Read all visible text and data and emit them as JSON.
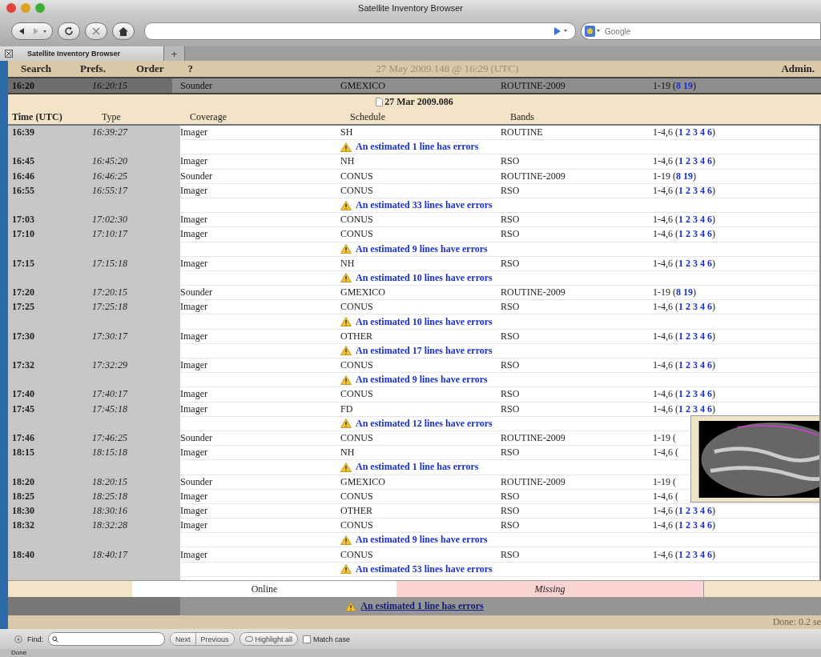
{
  "window": {
    "title": "Satellite Inventory Browser"
  },
  "toolbar": {
    "search_placeholder": "Google"
  },
  "tabs": [
    {
      "label": "Satellite Inventory Browser",
      "selected": true
    }
  ],
  "new_tab": "+",
  "menu": {
    "items": [
      "Search",
      "Prefs.",
      "Order",
      "?"
    ],
    "timestamp": "27 May 2009.148 @ 16:29 (UTC)",
    "admin": "Admin."
  },
  "current": {
    "time": "16:20",
    "time_exact": "16:20:15",
    "type": "Sounder",
    "coverage": "GMEXICO",
    "schedule": "ROUTINE-2009",
    "bands": {
      "prefix": "1-19 (",
      "links": [
        "8",
        "19"
      ],
      "suffix": ")"
    }
  },
  "date_header": "27 Mar 2009.086",
  "columns": [
    "Time (UTC)",
    "Type",
    "Coverage",
    "Schedule",
    "Bands"
  ],
  "rows": [
    {
      "kind": "data",
      "time": "16:39",
      "time_exact": "16:39:27",
      "type": "Imager",
      "coverage": "SH",
      "schedule": "ROUTINE",
      "bands": {
        "prefix": "1-4,6 (",
        "links": [
          "1",
          "2",
          "3",
          "4",
          "6"
        ],
        "suffix": ")"
      }
    },
    {
      "kind": "error",
      "text": "An estimated 1 line has errors"
    },
    {
      "kind": "data",
      "time": "16:45",
      "time_exact": "16:45:20",
      "type": "Imager",
      "coverage": "NH",
      "schedule": "RSO",
      "bands": {
        "prefix": "1-4,6 (",
        "links": [
          "1",
          "2",
          "3",
          "4",
          "6"
        ],
        "suffix": ")"
      }
    },
    {
      "kind": "data",
      "time": "16:46",
      "time_exact": "16:46:25",
      "type": "Sounder",
      "coverage": "CONUS",
      "schedule": "ROUTINE-2009",
      "bands": {
        "prefix": "1-19 (",
        "links": [
          "8",
          "19"
        ],
        "suffix": ")"
      }
    },
    {
      "kind": "data",
      "time": "16:55",
      "time_exact": "16:55:17",
      "type": "Imager",
      "coverage": "CONUS",
      "schedule": "RSO",
      "bands": {
        "prefix": "1-4,6 (",
        "links": [
          "1",
          "2",
          "3",
          "4",
          "6"
        ],
        "suffix": ")"
      }
    },
    {
      "kind": "error",
      "text": "An estimated 33 lines have errors"
    },
    {
      "kind": "data",
      "time": "17:03",
      "time_exact": "17:02:30",
      "type": "Imager",
      "coverage": "CONUS",
      "schedule": "RSO",
      "bands": {
        "prefix": "1-4,6 (",
        "links": [
          "1",
          "2",
          "3",
          "4",
          "6"
        ],
        "suffix": ")"
      }
    },
    {
      "kind": "data",
      "time": "17:10",
      "time_exact": "17:10:17",
      "type": "Imager",
      "coverage": "CONUS",
      "schedule": "RSO",
      "bands": {
        "prefix": "1-4,6 (",
        "links": [
          "1",
          "2",
          "3",
          "4",
          "6"
        ],
        "suffix": ")"
      }
    },
    {
      "kind": "error",
      "text": "An estimated 9 lines have errors"
    },
    {
      "kind": "data",
      "time": "17:15",
      "time_exact": "17:15:18",
      "type": "Imager",
      "coverage": "NH",
      "schedule": "RSO",
      "bands": {
        "prefix": "1-4,6 (",
        "links": [
          "1",
          "2",
          "3",
          "4",
          "6"
        ],
        "suffix": ")"
      }
    },
    {
      "kind": "error",
      "text": "An estimated 10 lines have errors"
    },
    {
      "kind": "data",
      "time": "17:20",
      "time_exact": "17:20:15",
      "type": "Sounder",
      "coverage": "GMEXICO",
      "schedule": "ROUTINE-2009",
      "bands": {
        "prefix": "1-19 (",
        "links": [
          "8",
          "19"
        ],
        "suffix": ")"
      }
    },
    {
      "kind": "data",
      "time": "17:25",
      "time_exact": "17:25:18",
      "type": "Imager",
      "coverage": "CONUS",
      "schedule": "RSO",
      "bands": {
        "prefix": "1-4,6 (",
        "links": [
          "1",
          "2",
          "3",
          "4",
          "6"
        ],
        "suffix": ")"
      }
    },
    {
      "kind": "error",
      "text": "An estimated 10 lines have errors"
    },
    {
      "kind": "data",
      "time": "17:30",
      "time_exact": "17:30:17",
      "type": "Imager",
      "coverage": "OTHER",
      "schedule": "RSO",
      "bands": {
        "prefix": "1-4,6 (",
        "links": [
          "1",
          "2",
          "3",
          "4",
          "6"
        ],
        "suffix": ")"
      }
    },
    {
      "kind": "error",
      "text": "An estimated 17 lines have errors"
    },
    {
      "kind": "data",
      "time": "17:32",
      "time_exact": "17:32:29",
      "type": "Imager",
      "coverage": "CONUS",
      "schedule": "RSO",
      "bands": {
        "prefix": "1-4,6 (",
        "links": [
          "1",
          "2",
          "3",
          "4",
          "6"
        ],
        "suffix": ")"
      }
    },
    {
      "kind": "error",
      "text": "An estimated 9 lines have errors"
    },
    {
      "kind": "data",
      "time": "17:40",
      "time_exact": "17:40:17",
      "type": "Imager",
      "coverage": "CONUS",
      "schedule": "RSO",
      "bands": {
        "prefix": "1-4,6 (",
        "links": [
          "1",
          "2",
          "3",
          "4",
          "6"
        ],
        "suffix": ")"
      }
    },
    {
      "kind": "data",
      "time": "17:45",
      "time_exact": "17:45:18",
      "type": "Imager",
      "coverage": "FD",
      "schedule": "RSO",
      "bands": {
        "prefix": "1-4,6 (",
        "links": [
          "1",
          "2",
          "3",
          "4",
          "6"
        ],
        "suffix": ")"
      }
    },
    {
      "kind": "error",
      "text": "An estimated 12 lines have errors"
    },
    {
      "kind": "data",
      "time": "17:46",
      "time_exact": "17:46:25",
      "type": "Sounder",
      "coverage": "CONUS",
      "schedule": "ROUTINE-2009",
      "bands": {
        "prefix": "1-19 ("
      }
    },
    {
      "kind": "data",
      "time": "18:15",
      "time_exact": "18:15:18",
      "type": "Imager",
      "coverage": "NH",
      "schedule": "RSO",
      "bands": {
        "prefix": "1-4,6 ("
      }
    },
    {
      "kind": "error",
      "text": "An estimated 1 line has errors"
    },
    {
      "kind": "data",
      "time": "18:20",
      "time_exact": "18:20:15",
      "type": "Sounder",
      "coverage": "GMEXICO",
      "schedule": "ROUTINE-2009",
      "bands": {
        "prefix": "1-19 ("
      }
    },
    {
      "kind": "data",
      "time": "18:25",
      "time_exact": "18:25:18",
      "type": "Imager",
      "coverage": "CONUS",
      "schedule": "RSO",
      "bands": {
        "prefix": "1-4,6 ("
      }
    },
    {
      "kind": "data",
      "time": "18:30",
      "time_exact": "18:30:16",
      "type": "Imager",
      "coverage": "OTHER",
      "schedule": "RSO",
      "bands": {
        "prefix": "1-4,6 (",
        "links": [
          "1",
          "2",
          "3",
          "4",
          "6"
        ],
        "suffix": ")"
      }
    },
    {
      "kind": "data",
      "time": "18:32",
      "time_exact": "18:32:28",
      "type": "Imager",
      "coverage": "CONUS",
      "schedule": "RSO",
      "bands": {
        "prefix": "1-4,6 (",
        "links": [
          "1",
          "2",
          "3",
          "4",
          "6"
        ],
        "suffix": ")"
      }
    },
    {
      "kind": "error",
      "text": "An estimated 9 lines have errors"
    },
    {
      "kind": "data",
      "time": "18:40",
      "time_exact": "18:40:17",
      "type": "Imager",
      "coverage": "CONUS",
      "schedule": "RSO",
      "bands": {
        "prefix": "1-4,6 (",
        "links": [
          "1",
          "2",
          "3",
          "4",
          "6"
        ],
        "suffix": ")"
      }
    },
    {
      "kind": "error",
      "text": "An estimated 53 lines have errors"
    }
  ],
  "legend": [
    {
      "label": "Online",
      "kind": "online"
    },
    {
      "label": "Missing",
      "kind": "missing"
    }
  ],
  "summary": "An estimated 1 line has errors",
  "page_status": "Done: 0.2 se",
  "find_bar": {
    "label": "Find:",
    "buttons": [
      "Next",
      "Previous"
    ],
    "highlight": "Highlight all",
    "match_case": {
      "label": "Match case",
      "checked": false
    }
  },
  "status": "Done"
}
